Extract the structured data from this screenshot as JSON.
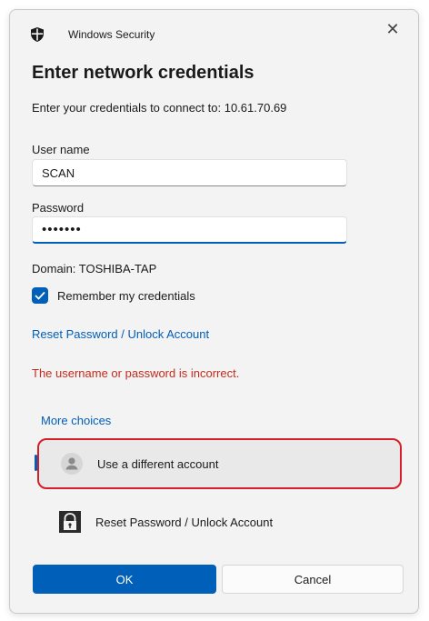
{
  "window": {
    "app_title": "Windows Security",
    "close_glyph": "✕"
  },
  "dialog": {
    "heading": "Enter network credentials",
    "subtitle": "Enter your credentials to connect to: 10.61.70.69"
  },
  "form": {
    "username_label": "User name",
    "username_value": "SCAN",
    "password_label": "Password",
    "password_value": "•••••••",
    "domain_text": "Domain: TOSHIBA-TAP",
    "remember_label": "Remember my credentials",
    "remember_checked": true,
    "reset_link": "Reset Password / Unlock Account",
    "error_message": "The username or password is incorrect."
  },
  "choices": {
    "header": "More choices",
    "items": [
      {
        "label": "Use a different account",
        "icon": "person-icon"
      },
      {
        "label": "Reset Password / Unlock Account",
        "icon": "lock-key-icon"
      }
    ]
  },
  "buttons": {
    "ok": "OK",
    "cancel": "Cancel"
  },
  "colors": {
    "accent": "#005fb8",
    "error": "#c42b1c",
    "highlight_border": "#d42028"
  }
}
